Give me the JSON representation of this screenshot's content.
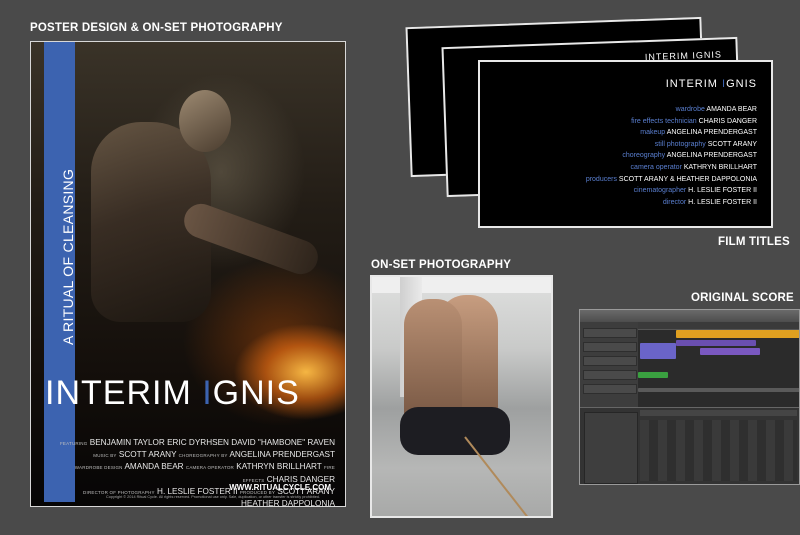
{
  "labels": {
    "poster_section": "POSTER DESIGN & ON-SET PHOTOGRAPHY",
    "onset_section": "ON-SET PHOTOGRAPHY",
    "film_titles_section": "FILM TITLES",
    "score_section": "ORIGINAL SCORE"
  },
  "poster": {
    "tagline": "A RITUAL OF CLEANSING",
    "title_first": "INTERIM ",
    "title_accent": "I",
    "title_rest": "GNIS",
    "credit_lines": [
      {
        "small": "FEATURING",
        "text": "BENJAMIN TAYLOR   ERIC DYRHSEN   DAVID \"HAMBONE\" RAVEN"
      },
      {
        "small": "MUSIC BY",
        "text": "SCOTT ARANY",
        "small2": "CHOREOGRAPHY BY",
        "text2": "ANGELINA PRENDERGAST"
      },
      {
        "small": "WARDROBE DESIGN",
        "text": "AMANDA BEAR",
        "small2": "CAMERA OPERATOR",
        "text2": "KATHRYN BRILLHART",
        "small3": "FIRE EFFECTS",
        "text3": "CHARIS DANGER"
      },
      {
        "small": "DIRECTOR OF PHOTOGRAPHY",
        "text": "H. LESLIE FOSTER II",
        "small2": "PRODUCED BY",
        "text2": "SCOTT ARANY  HEATHER DAPPOLONIA"
      }
    ],
    "url": "WWW.RITUALCYCLE.COM",
    "copyright": "Copyright © 2014 Ritual Cycle. All rights reserved. Promotional use only. Sale, duplication, or other transfer is strictly prohibited."
  },
  "film_titles": {
    "back_title": "INTERIM IGNIS",
    "title_first": "INTERIM ",
    "title_accent": "I",
    "title_rest": "GNIS",
    "rows": [
      {
        "role": "wardrobe",
        "name": "AMANDA BEAR"
      },
      {
        "role": "fire effects technician",
        "name": "CHARIS DANGER"
      },
      {
        "role": "makeup",
        "name": "ANGELINA PRENDERGAST"
      },
      {
        "role": "still photography",
        "name": "SCOTT ARANY"
      },
      {
        "role": "choreography",
        "name": "ANGELINA PRENDERGAST"
      },
      {
        "role": "camera operator",
        "name": "KATHRYN BRILLHART"
      },
      {
        "role": "producers",
        "name": "SCOTT ARANY & HEATHER DAPPOLONIA"
      },
      {
        "role": "cinematographer",
        "name": "H. LESLIE FOSTER II"
      },
      {
        "role": "director",
        "name": "H. LESLIE FOSTER II"
      }
    ]
  },
  "colors": {
    "accent_blue": "#3c63b0",
    "background": "#4a4a4a"
  }
}
